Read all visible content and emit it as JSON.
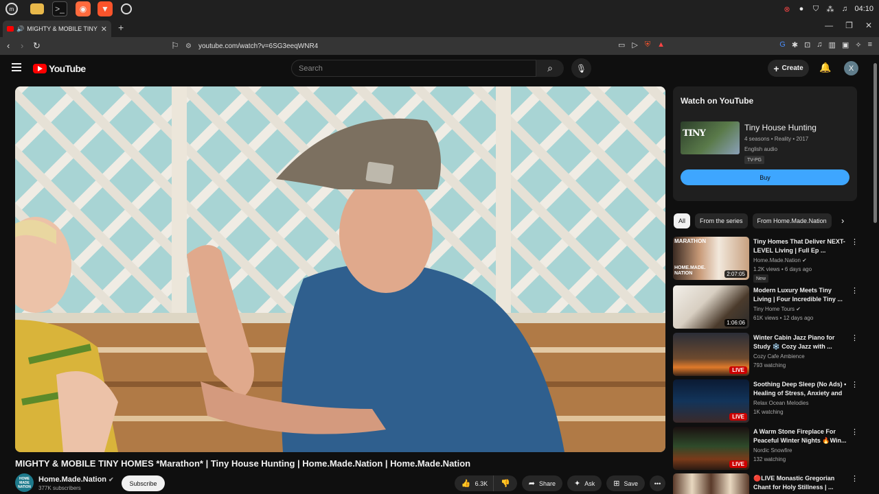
{
  "os": {
    "clock": "04:10",
    "apps": [
      "files-icon",
      "terminal-icon",
      "firefox-icon",
      "brave-icon",
      "chrome-icon"
    ]
  },
  "browser": {
    "tab_title": "MIGHTY & MOBILE TINY HO",
    "url": "youtube.com/watch?v=6SG3eeqWNR4"
  },
  "youtube": {
    "logo_text": "YouTube",
    "search_placeholder": "Search",
    "create_label": "Create",
    "avatar_letter": "X"
  },
  "video": {
    "title": "MIGHTY & MOBILE TINY HOMES *Marathon* | Tiny House Hunting | Home.Made.Nation | Home.Made.Nation",
    "channel": "Home.Made.Nation",
    "subscribers": "377K subscribers",
    "subscribe_label": "Subscribe",
    "likes": "6.3K",
    "share_label": "Share",
    "ask_label": "Ask",
    "save_label": "Save",
    "channel_avatar_text": "HOME MADE NATION"
  },
  "watch_panel": {
    "heading": "Watch on YouTube",
    "show_title": "Tiny House Hunting",
    "meta": "4 seasons • Reality • 2017",
    "audio": "English audio",
    "rating": "TV-PG",
    "buy_label": "Buy",
    "thumb_text": "TINY"
  },
  "chips": [
    "All",
    "From the series",
    "From Home.Made.Nation"
  ],
  "recommendations": [
    {
      "title": "Tiny Homes That Deliver NEXT-LEVEL Living | Full Ep ...",
      "channel": "Home.Made.Nation",
      "stats": "1.2K views • 6 days ago",
      "badge": "2:07:05",
      "new": "New",
      "live": false
    },
    {
      "title": "Modern Luxury Meets Tiny Living | Four Incredible Tiny ...",
      "channel": "Tiny Home Tours",
      "stats": "61K views • 12 days ago",
      "badge": "1:06:06",
      "live": false
    },
    {
      "title": "Winter Cabin Jazz Piano for Study ❄️ Cozy Jazz with ...",
      "channel": "Cozy Cafe Ambience",
      "stats": "793 watching",
      "badge": "LIVE",
      "live": true
    },
    {
      "title": "Soothing Deep Sleep (No Ads) • Healing of Stress, Anxiety and ...",
      "channel": "Relax Ocean Melodies",
      "stats": "1K watching",
      "badge": "LIVE",
      "live": true
    },
    {
      "title": "A Warm Stone Fireplace For Peaceful Winter Nights 🔥Win...",
      "channel": "Nordic Snowfire",
      "stats": "132 watching",
      "badge": "LIVE",
      "live": true
    },
    {
      "title": "🔴LIVE Monastic Gregorian Chant for Holy Stillness | ...",
      "channel": "",
      "stats": "",
      "badge": "",
      "live": false
    }
  ],
  "thumb_labels": {
    "marathon": "MARATHON",
    "home_made_nation": "HOME.MADE. NATION"
  },
  "colors": {
    "accent": "#3ea6ff",
    "brand": "#ff0000",
    "live": "#cc0000"
  }
}
